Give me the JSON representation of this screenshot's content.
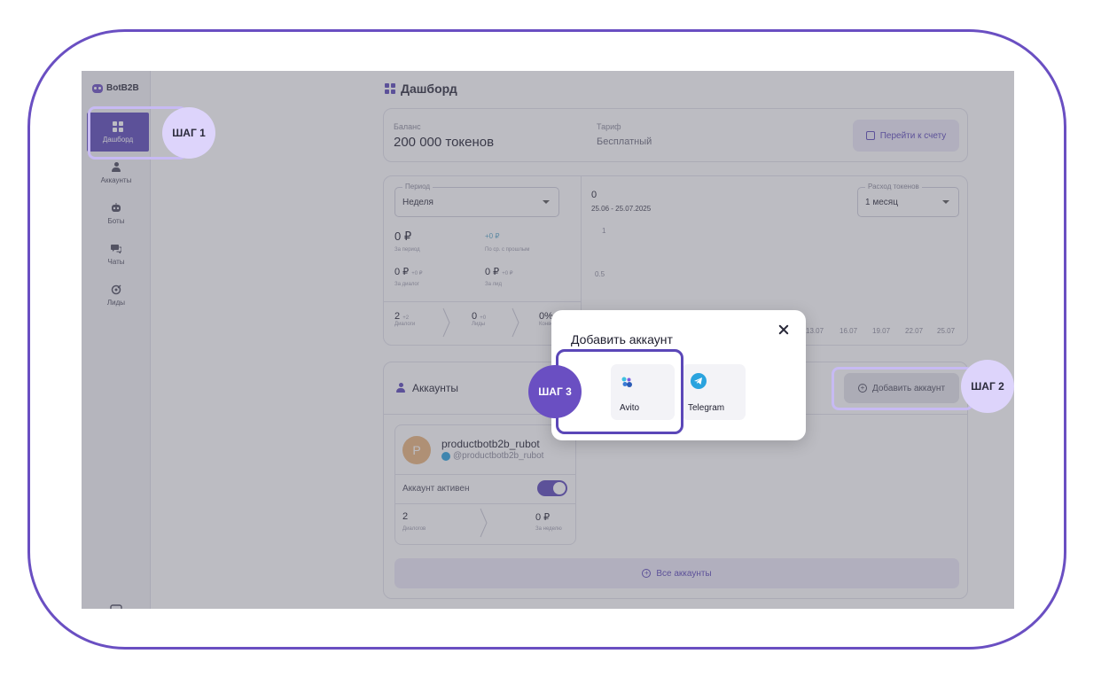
{
  "app": {
    "logo_text": "BotB2B"
  },
  "sidebar": {
    "items": [
      {
        "label": "Дашборд",
        "icon": "dashboard-grid-icon",
        "active": true
      },
      {
        "label": "Аккаунты",
        "icon": "user-icon"
      },
      {
        "label": "Боты",
        "icon": "bot-icon"
      },
      {
        "label": "Чаты",
        "icon": "chat-icon"
      },
      {
        "label": "Лиды",
        "icon": "leads-icon"
      }
    ],
    "bottom_icon": "wallet-icon"
  },
  "page": {
    "title": "Дашборд"
  },
  "balance": {
    "label": "Баланс",
    "value": "200 000 токенов",
    "tariff_label": "Тариф",
    "tariff_value": "Бесплатный",
    "go_to_account": "Перейти к счету"
  },
  "stats": {
    "period_legend": "Период",
    "period_value": "Неделя",
    "total": "0 ₽",
    "total_sub": "За период",
    "delta": "+0 ₽",
    "delta_sub": "По ср. с прошлым",
    "per_dialog": "0 ₽",
    "per_dialog_delta": "+0 ₽",
    "per_dialog_sub": "За диалог",
    "per_lead": "0 ₽",
    "per_lead_delta": "+0 ₽",
    "per_lead_sub": "За лид",
    "funnel": [
      {
        "value": "2",
        "delta": "+2",
        "label": "Диалоги"
      },
      {
        "value": "0",
        "delta": "+0",
        "label": "Лиды"
      },
      {
        "value": "0%",
        "delta": "",
        "label": "Конверсия"
      }
    ]
  },
  "chart": {
    "value": "0",
    "date_range": "25.06 - 25.07.2025",
    "legend": "Расход токенов",
    "range_value": "1 месяц",
    "y_ticks": [
      "1",
      "0.5"
    ],
    "x_ticks": [
      "13.07",
      "16.07",
      "19.07",
      "22.07",
      "25.07"
    ]
  },
  "accounts": {
    "title": "Аккаунты",
    "add_button": "Добавить аккаунт",
    "all_button": "Все аккаунты",
    "card": {
      "avatar_letter": "P",
      "name": "productbotb2b_rubot",
      "handle": "@productbotb2b_rubot",
      "active_label": "Аккаунт активен",
      "active": true,
      "dialogs_value": "2",
      "dialogs_label": "Диалогов",
      "spend_value": "0 ₽",
      "spend_label": "За неделю"
    }
  },
  "modal": {
    "title": "Добавить аккаунт",
    "options": [
      {
        "label": "Avito",
        "icon": "avito-icon"
      },
      {
        "label": "Telegram",
        "icon": "telegram-icon"
      }
    ]
  },
  "steps": {
    "step1": "ШАГ 1",
    "step2": "ШАГ 2",
    "step3": "ШАГ 3"
  },
  "colors": {
    "accent": "#5b47b8",
    "frame": "#6a4fc2",
    "step_light": "#ddd4fb",
    "telegram": "#2aa3de"
  }
}
